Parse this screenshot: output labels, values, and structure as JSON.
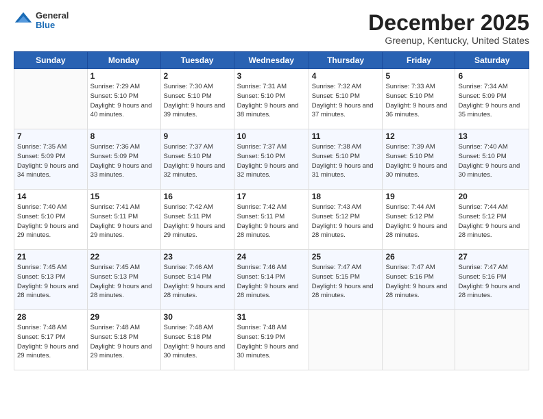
{
  "logo": {
    "general": "General",
    "blue": "Blue"
  },
  "title": "December 2025",
  "location": "Greenup, Kentucky, United States",
  "days_of_week": [
    "Sunday",
    "Monday",
    "Tuesday",
    "Wednesday",
    "Thursday",
    "Friday",
    "Saturday"
  ],
  "weeks": [
    [
      {
        "num": "",
        "sunrise": "",
        "sunset": "",
        "daylight": ""
      },
      {
        "num": "1",
        "sunrise": "Sunrise: 7:29 AM",
        "sunset": "Sunset: 5:10 PM",
        "daylight": "Daylight: 9 hours and 40 minutes."
      },
      {
        "num": "2",
        "sunrise": "Sunrise: 7:30 AM",
        "sunset": "Sunset: 5:10 PM",
        "daylight": "Daylight: 9 hours and 39 minutes."
      },
      {
        "num": "3",
        "sunrise": "Sunrise: 7:31 AM",
        "sunset": "Sunset: 5:10 PM",
        "daylight": "Daylight: 9 hours and 38 minutes."
      },
      {
        "num": "4",
        "sunrise": "Sunrise: 7:32 AM",
        "sunset": "Sunset: 5:10 PM",
        "daylight": "Daylight: 9 hours and 37 minutes."
      },
      {
        "num": "5",
        "sunrise": "Sunrise: 7:33 AM",
        "sunset": "Sunset: 5:10 PM",
        "daylight": "Daylight: 9 hours and 36 minutes."
      },
      {
        "num": "6",
        "sunrise": "Sunrise: 7:34 AM",
        "sunset": "Sunset: 5:09 PM",
        "daylight": "Daylight: 9 hours and 35 minutes."
      }
    ],
    [
      {
        "num": "7",
        "sunrise": "Sunrise: 7:35 AM",
        "sunset": "Sunset: 5:09 PM",
        "daylight": "Daylight: 9 hours and 34 minutes."
      },
      {
        "num": "8",
        "sunrise": "Sunrise: 7:36 AM",
        "sunset": "Sunset: 5:09 PM",
        "daylight": "Daylight: 9 hours and 33 minutes."
      },
      {
        "num": "9",
        "sunrise": "Sunrise: 7:37 AM",
        "sunset": "Sunset: 5:10 PM",
        "daylight": "Daylight: 9 hours and 32 minutes."
      },
      {
        "num": "10",
        "sunrise": "Sunrise: 7:37 AM",
        "sunset": "Sunset: 5:10 PM",
        "daylight": "Daylight: 9 hours and 32 minutes."
      },
      {
        "num": "11",
        "sunrise": "Sunrise: 7:38 AM",
        "sunset": "Sunset: 5:10 PM",
        "daylight": "Daylight: 9 hours and 31 minutes."
      },
      {
        "num": "12",
        "sunrise": "Sunrise: 7:39 AM",
        "sunset": "Sunset: 5:10 PM",
        "daylight": "Daylight: 9 hours and 30 minutes."
      },
      {
        "num": "13",
        "sunrise": "Sunrise: 7:40 AM",
        "sunset": "Sunset: 5:10 PM",
        "daylight": "Daylight: 9 hours and 30 minutes."
      }
    ],
    [
      {
        "num": "14",
        "sunrise": "Sunrise: 7:40 AM",
        "sunset": "Sunset: 5:10 PM",
        "daylight": "Daylight: 9 hours and 29 minutes."
      },
      {
        "num": "15",
        "sunrise": "Sunrise: 7:41 AM",
        "sunset": "Sunset: 5:11 PM",
        "daylight": "Daylight: 9 hours and 29 minutes."
      },
      {
        "num": "16",
        "sunrise": "Sunrise: 7:42 AM",
        "sunset": "Sunset: 5:11 PM",
        "daylight": "Daylight: 9 hours and 29 minutes."
      },
      {
        "num": "17",
        "sunrise": "Sunrise: 7:42 AM",
        "sunset": "Sunset: 5:11 PM",
        "daylight": "Daylight: 9 hours and 28 minutes."
      },
      {
        "num": "18",
        "sunrise": "Sunrise: 7:43 AM",
        "sunset": "Sunset: 5:12 PM",
        "daylight": "Daylight: 9 hours and 28 minutes."
      },
      {
        "num": "19",
        "sunrise": "Sunrise: 7:44 AM",
        "sunset": "Sunset: 5:12 PM",
        "daylight": "Daylight: 9 hours and 28 minutes."
      },
      {
        "num": "20",
        "sunrise": "Sunrise: 7:44 AM",
        "sunset": "Sunset: 5:12 PM",
        "daylight": "Daylight: 9 hours and 28 minutes."
      }
    ],
    [
      {
        "num": "21",
        "sunrise": "Sunrise: 7:45 AM",
        "sunset": "Sunset: 5:13 PM",
        "daylight": "Daylight: 9 hours and 28 minutes."
      },
      {
        "num": "22",
        "sunrise": "Sunrise: 7:45 AM",
        "sunset": "Sunset: 5:13 PM",
        "daylight": "Daylight: 9 hours and 28 minutes."
      },
      {
        "num": "23",
        "sunrise": "Sunrise: 7:46 AM",
        "sunset": "Sunset: 5:14 PM",
        "daylight": "Daylight: 9 hours and 28 minutes."
      },
      {
        "num": "24",
        "sunrise": "Sunrise: 7:46 AM",
        "sunset": "Sunset: 5:14 PM",
        "daylight": "Daylight: 9 hours and 28 minutes."
      },
      {
        "num": "25",
        "sunrise": "Sunrise: 7:47 AM",
        "sunset": "Sunset: 5:15 PM",
        "daylight": "Daylight: 9 hours and 28 minutes."
      },
      {
        "num": "26",
        "sunrise": "Sunrise: 7:47 AM",
        "sunset": "Sunset: 5:16 PM",
        "daylight": "Daylight: 9 hours and 28 minutes."
      },
      {
        "num": "27",
        "sunrise": "Sunrise: 7:47 AM",
        "sunset": "Sunset: 5:16 PM",
        "daylight": "Daylight: 9 hours and 28 minutes."
      }
    ],
    [
      {
        "num": "28",
        "sunrise": "Sunrise: 7:48 AM",
        "sunset": "Sunset: 5:17 PM",
        "daylight": "Daylight: 9 hours and 29 minutes."
      },
      {
        "num": "29",
        "sunrise": "Sunrise: 7:48 AM",
        "sunset": "Sunset: 5:18 PM",
        "daylight": "Daylight: 9 hours and 29 minutes."
      },
      {
        "num": "30",
        "sunrise": "Sunrise: 7:48 AM",
        "sunset": "Sunset: 5:18 PM",
        "daylight": "Daylight: 9 hours and 30 minutes."
      },
      {
        "num": "31",
        "sunrise": "Sunrise: 7:48 AM",
        "sunset": "Sunset: 5:19 PM",
        "daylight": "Daylight: 9 hours and 30 minutes."
      },
      {
        "num": "",
        "sunrise": "",
        "sunset": "",
        "daylight": ""
      },
      {
        "num": "",
        "sunrise": "",
        "sunset": "",
        "daylight": ""
      },
      {
        "num": "",
        "sunrise": "",
        "sunset": "",
        "daylight": ""
      }
    ]
  ]
}
